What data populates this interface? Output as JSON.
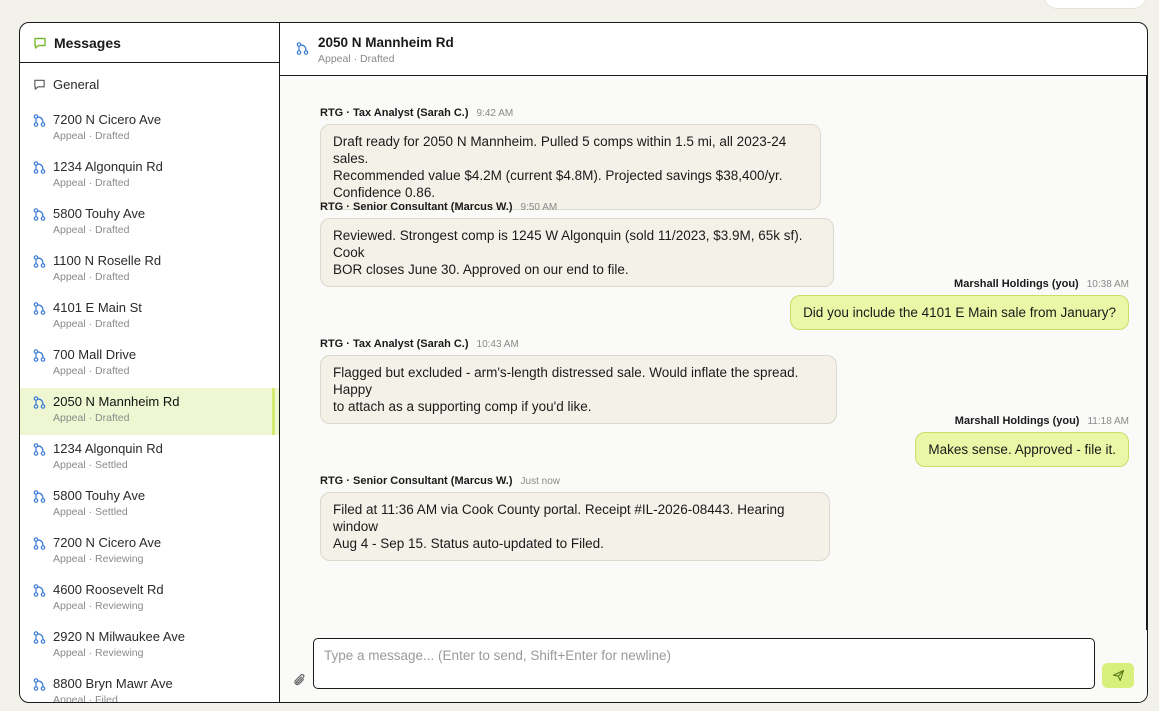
{
  "sidebar": {
    "title": "Messages",
    "general_label": "General",
    "items": [
      {
        "name": "7200 N Cicero Ave",
        "sub": "Appeal · Drafted",
        "active": false
      },
      {
        "name": "1234 Algonquin Rd",
        "sub": "Appeal · Drafted",
        "active": false
      },
      {
        "name": "5800 Touhy Ave",
        "sub": "Appeal · Drafted",
        "active": false
      },
      {
        "name": "1100 N Roselle Rd",
        "sub": "Appeal · Drafted",
        "active": false
      },
      {
        "name": "4101 E Main St",
        "sub": "Appeal · Drafted",
        "active": false
      },
      {
        "name": "700 Mall Drive",
        "sub": "Appeal · Drafted",
        "active": false
      },
      {
        "name": "2050 N Mannheim Rd",
        "sub": "Appeal · Drafted",
        "active": true
      },
      {
        "name": "1234 Algonquin Rd",
        "sub": "Appeal · Settled",
        "active": false
      },
      {
        "name": "5800 Touhy Ave",
        "sub": "Appeal · Settled",
        "active": false
      },
      {
        "name": "7200 N Cicero Ave",
        "sub": "Appeal · Reviewing",
        "active": false
      },
      {
        "name": "4600 Roosevelt Rd",
        "sub": "Appeal · Reviewing",
        "active": false
      },
      {
        "name": "2920 N Milwaukee Ave",
        "sub": "Appeal · Reviewing",
        "active": false
      },
      {
        "name": "8800 Bryn Mawr Ave",
        "sub": "Appeal · Filed",
        "active": false
      }
    ]
  },
  "header": {
    "title": "2050 N Mannheim Rd",
    "sub": "Appeal · Drafted"
  },
  "messages": [
    {
      "sender": "RTG · Tax Analyst (Sarah C.)",
      "time": "9:42 AM",
      "direction": "incoming",
      "lines": [
        "Draft ready for 2050 N Mannheim. Pulled 5 comps within 1.5 mi, all 2023-24 sales.",
        "Recommended value $4.2M (current $4.8M). Projected savings $38,400/yr.",
        "Confidence 0.86."
      ]
    },
    {
      "sender": "RTG · Senior Consultant (Marcus W.)",
      "time": "9:50 AM",
      "direction": "incoming",
      "lines": [
        "Reviewed. Strongest comp is 1245 W Algonquin (sold 11/2023, $3.9M, 65k sf). Cook",
        "BOR closes June 30. Approved on our end to file."
      ]
    },
    {
      "sender": "Marshall Holdings (you)",
      "time": "10:38 AM",
      "direction": "outgoing",
      "lines": [
        "Did you include the 4101 E Main sale from January?"
      ]
    },
    {
      "sender": "RTG · Tax Analyst (Sarah C.)",
      "time": "10:43 AM",
      "direction": "incoming",
      "lines": [
        "Flagged but excluded - arm's-length distressed sale. Would inflate the spread. Happy",
        "to attach as a supporting comp if you'd like."
      ]
    },
    {
      "sender": "Marshall Holdings (you)",
      "time": "11:18 AM",
      "direction": "outgoing",
      "lines": [
        "Makes sense. Approved - file it."
      ]
    },
    {
      "sender": "RTG · Senior Consultant (Marcus W.)",
      "time": "Just now",
      "direction": "incoming",
      "lines": [
        "Filed at 11:36 AM via Cook County portal. Receipt #IL-2026-08443. Hearing window",
        "Aug 4 - Sep 15. Status auto-updated to Filed."
      ]
    }
  ],
  "composer": {
    "placeholder": "Type a message... (Enter to send, Shift+Enter for newline)"
  },
  "icons": {
    "sidebar_header": "chat-bubble-icon",
    "general": "chat-bubble-icon",
    "conversation": "git-branch-icon",
    "attach": "paperclip-icon",
    "send": "send-icon"
  },
  "colors": {
    "accent": "#d7ef7c",
    "active_row": "#eef7d2",
    "outgoing_bubble": "#eaf7a6",
    "incoming_bubble": "#f4f1e8",
    "icon_blue": "#3a7bd5",
    "header_icon_green": "#7cb82f"
  }
}
